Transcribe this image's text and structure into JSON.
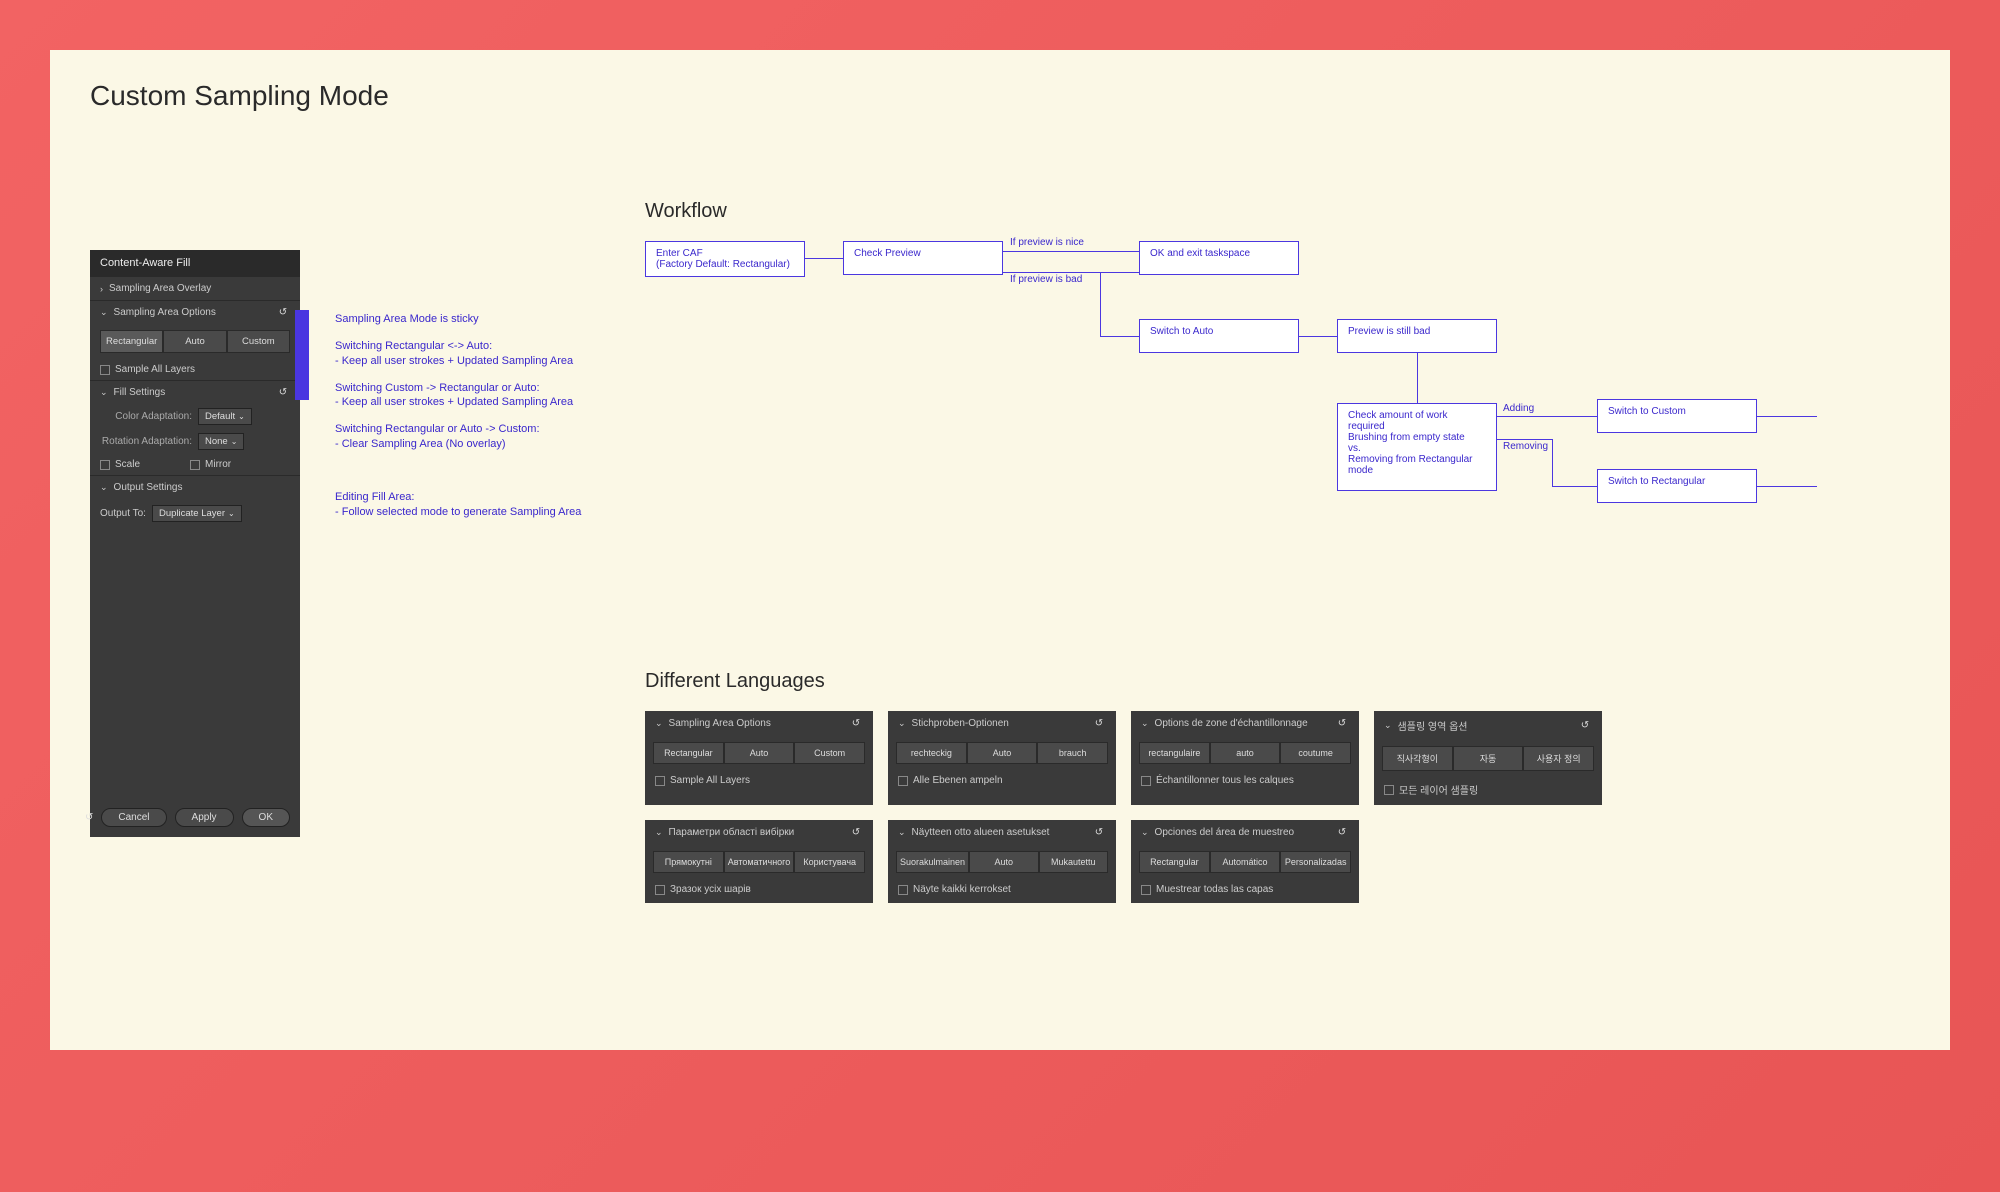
{
  "page_title": "Custom Sampling Mode",
  "panel": {
    "header": "Content-Aware Fill",
    "overlay_section": "Sampling Area Overlay",
    "options_section": "Sampling Area Options",
    "seg": {
      "rect": "Rectangular",
      "auto": "Auto",
      "custom": "Custom"
    },
    "sample_all": "Sample All Layers",
    "fill_section": "Fill Settings",
    "color_adapt_label": "Color Adaptation:",
    "color_adapt_value": "Default",
    "rotation_adapt_label": "Rotation Adaptation:",
    "rotation_adapt_value": "None",
    "scale": "Scale",
    "mirror": "Mirror",
    "output_section": "Output Settings",
    "output_to_label": "Output To:",
    "output_to_value": "Duplicate Layer",
    "footer": {
      "cancel": "Cancel",
      "apply": "Apply",
      "ok": "OK"
    }
  },
  "notes": {
    "n1": "Sampling Area Mode is sticky",
    "n2a": "Switching Rectangular <-> Auto:",
    "n2b": "- Keep all user strokes + Updated Sampling Area",
    "n3a": "Switching Custom -> Rectangular or Auto:",
    "n3b": "- Keep all user strokes + Updated Sampling Area",
    "n4a": "Switching Rectangular or Auto -> Custom:",
    "n4b": "- Clear Sampling Area (No overlay)",
    "n5a": "Editing Fill Area:",
    "n5b": "- Follow selected mode to generate Sampling Area"
  },
  "workflow": {
    "title": "Workflow",
    "b1a": "Enter CAF",
    "b1b": "(Factory Default: Rectangular)",
    "b2": "Check Preview",
    "l_nice": "If preview is nice",
    "l_bad": "If preview is bad",
    "b3": "OK and exit taskspace",
    "b4": "Switch to Auto",
    "b5": "Preview is still bad",
    "b6a": "Check amount of work required",
    "b6b": "Brushing from empty state",
    "b6c": "vs.",
    "b6d": "Removing from Rectangular mode",
    "l_adding": "Adding",
    "l_removing": "Removing",
    "b7": "Switch to Custom",
    "b8": "Switch to Rectangular"
  },
  "languages": {
    "title": "Different Languages",
    "panels": [
      {
        "head": "Sampling Area Options",
        "b1": "Rectangular",
        "b2": "Auto",
        "b3": "Custom",
        "check": "Sample All Layers"
      },
      {
        "head": "Stichproben-Optionen",
        "b1": "rechteckig",
        "b2": "Auto",
        "b3": "brauch",
        "check": "Alle Ebenen ampeln"
      },
      {
        "head": "Options de zone d'échantillonnage",
        "b1": "rectangulaire",
        "b2": "auto",
        "b3": "coutume",
        "check": "Échantillonner tous les calques"
      },
      {
        "head": "샘플링 영역 옵션",
        "b1": "직사각형이",
        "b2": "자동",
        "b3": "사용자 정의",
        "check": "모든 레이어 샘플링"
      },
      {
        "head": "Параметри області вибірки",
        "b1": "Прямокутні",
        "b2": "Автоматичного",
        "b3": "Користувача",
        "check": "Зразок усіх шарів"
      },
      {
        "head": "Näytteen otto alueen asetukset",
        "b1": "Suorakulmainen",
        "b2": "Auto",
        "b3": "Mukautettu",
        "check": "Näyte kaikki kerrokset"
      },
      {
        "head": "Opciones del área de muestreo",
        "b1": "Rectangular",
        "b2": "Automático",
        "b3": "Personalizadas",
        "check": "Muestrear todas las capas"
      }
    ]
  }
}
